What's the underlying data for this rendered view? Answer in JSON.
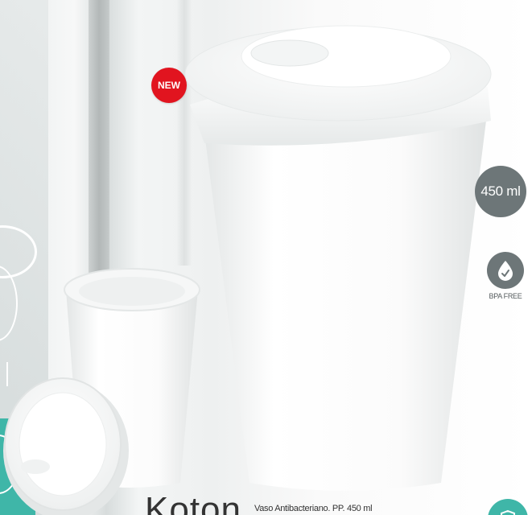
{
  "badges": {
    "new": "NEW",
    "capacity": "450 ml",
    "bpa_free": "BPA FREE"
  },
  "product": {
    "name": "Koton",
    "description": "Vaso Antibacteriano. PP. 450 ml"
  },
  "colors": {
    "new_badge": "#e1141f",
    "feature_badge": "#6d7678",
    "accent_teal": "#3fb6a8",
    "cup_white": "#ffffff"
  },
  "icons": [
    "water-drop-check-icon",
    "shield-icon"
  ]
}
